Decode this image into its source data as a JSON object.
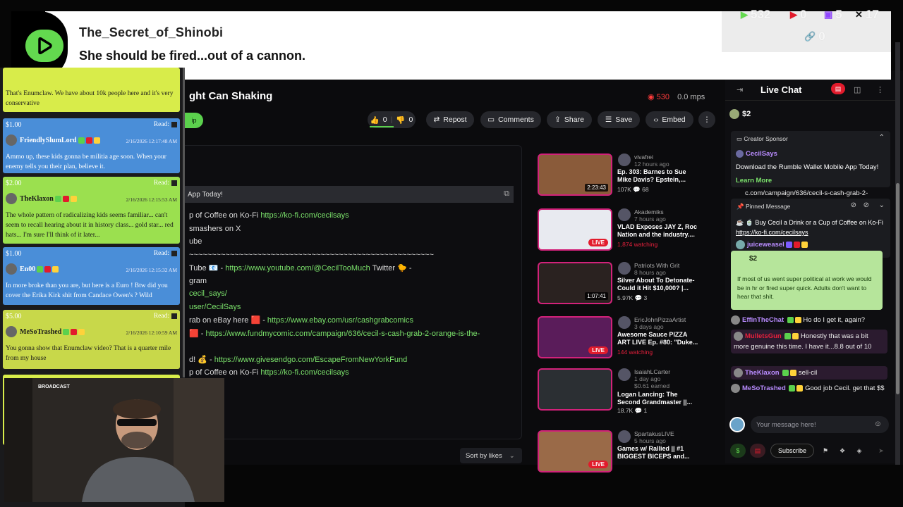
{
  "banner": {
    "username": "The_Secret_of_Shinobi",
    "message": "She should be fired...out of a cannon."
  },
  "counts": {
    "rumble": "532",
    "youtube": "0",
    "twitch": "5",
    "x": "17",
    "link": "0"
  },
  "video": {
    "title": "ght Can Shaking",
    "live_count": "530",
    "mps": "0.0 mps",
    "likes": "0",
    "dislikes": "0",
    "tip_label": "ip",
    "buttons": {
      "repost": "Repost",
      "comments": "Comments",
      "share": "Share",
      "save": "Save",
      "embed": "Embed"
    },
    "sponsor_bar": "App Today!",
    "sort_label": "Sort by likes"
  },
  "description": [
    {
      "text": "p of Coffee on Ko-Fi ",
      "link": "https://ko-fi.com/cecilsays"
    },
    {
      "text": "smashers on X",
      "link": ""
    },
    {
      "text": "ube",
      "link": ""
    },
    {
      "text": "~~~~~~~~~~~~~~~~~~~~~~~~~~~~~~~~~~~~~~~~~~~~~~~~~~~~~~",
      "link": ""
    },
    {
      "text": "Tube 📧 - ",
      "link": "https://www.youtube.com/@CecilTooMuch",
      "after": " Twitter 🐤 -"
    },
    {
      "text": "gram",
      "link": ""
    },
    {
      "text": "",
      "link": "cecil_says/"
    },
    {
      "text": "",
      "link": "user/CecilSays"
    },
    {
      "text": "rab on eBay here 🟥 - ",
      "link": "https://www.ebay.com/usr/cashgrabcomics"
    },
    {
      "text": " 🟥 - ",
      "link": "https://www.fundmycomic.com/campaign/636/cecil-s-cash-grab-2-orange-is-the-"
    },
    {
      "text": "",
      "link": ""
    },
    {
      "text": "d! 💰 - ",
      "link": "https://www.givesendgo.com/EscapeFromNewYorkFund"
    },
    {
      "text": "p of Coffee on Ko-Fi ",
      "link": "https://ko-fi.com/cecilsays"
    }
  ],
  "recommended": [
    {
      "channel": "vivafrei",
      "ago": "12 hours ago",
      "title": "Ep. 303: Barnes to Sue Mike Davis? Epstein,...",
      "meta": "107K   💬 68",
      "duration": "2:23:43",
      "live": false
    },
    {
      "channel": "Akademiks",
      "ago": "7 hours ago",
      "title": "VLAD Exposes JAY Z, Roc Nation and the industry....",
      "meta": "1,874 watching",
      "duration": "",
      "live": true
    },
    {
      "channel": "Patriots With Grit",
      "ago": "8 hours ago",
      "title": "Silver About To Detonate- Could it Hit $10,000? |...",
      "meta": "5.97K   💬 3",
      "duration": "1:07:41",
      "live": false
    },
    {
      "channel": "EricJohnPizzaArtist",
      "ago": "3 days ago",
      "title": "Awesome Sauce PIZZA ART LIVE Ep. #80: \"Duke...",
      "meta": "144 watching",
      "duration": "",
      "live": true
    },
    {
      "channel": "IsaiahLCarter",
      "ago": "1 day ago",
      "title": "Logan Lancing: The Second Grandmaster ||...",
      "meta": "18.7K   💬 1",
      "earned": "$0.61 earned",
      "duration": "",
      "live": false
    },
    {
      "channel": "SpartakusLIVE",
      "ago": "5 hours ago",
      "title": "Games w/ Rallied || #1 BIGGEST BICEPS and...",
      "meta": "",
      "duration": "",
      "live": true
    }
  ],
  "donations": [
    {
      "amount": "",
      "read": "",
      "user": "",
      "date": "",
      "text": "That's Enumclaw. We have about 10k people here and it's very conservative",
      "color": "#d8ec4a"
    },
    {
      "amount": "$1.00",
      "read": "Read:",
      "user": "FriendlySlumLord",
      "date": "2/16/2026 12:17:48 AM",
      "text": "Ammo up, these kids gonna be militia age soon. When your enemy tells you their plan, believe it.",
      "color": "#4a8ed8"
    },
    {
      "amount": "$2.00",
      "read": "Read:",
      "user": "TheKlaxon",
      "date": "2/16/2026 12:15:53 AM",
      "text": "The whole pattern of radicalizing kids seems familiar... can't seem to recall hearing about it in history class... gold star... red hats... I'm sure I'll think of it later...",
      "color": "#9be04f"
    },
    {
      "amount": "$1.00",
      "read": "Read:",
      "user": "En00",
      "date": "2/16/2026 12:15:32 AM",
      "text": "In more broke than you are, but here is a Euro ! Btw did you cover the Erika Kirk shit from Candace Owen's ? Wild",
      "color": "#4a8ed8"
    },
    {
      "amount": "$5.00",
      "read": "Read:",
      "user": "MeSoTrashed",
      "date": "2/16/2026 12:10:59 AM",
      "text": "You gonna show that Enumclaw video? That is a quarter mile from my house",
      "color": "#c8d84a"
    }
  ],
  "webcam_label": "BROADCAST",
  "chat": {
    "title": "Live Chat",
    "tip_strip": "$2",
    "sponsor_title": "Creator Sponsor",
    "sponsor_user": "CecilSays",
    "sponsor_text": "Download the Rumble Wallet Mobile App Today!",
    "sponsor_learn": "Learn More",
    "sponsor_peek": "c.com/campaign/636/cecil-s-cash-grab-2-",
    "pinned_title": "Pinned Message",
    "pinned_text": "☕ 🍵 Buy Cecil a Drink or a Cup of Coffee on Ko-Fi ",
    "pinned_link": "https://ko-fi.com/cecilsays",
    "pinned_user": "juiceweasel",
    "tip_amount": "$2",
    "tip_text": "If most of us went super political at work we would be in hr or fired super quick. Adults don't want to hear that shit.",
    "messages": [
      {
        "user": "EffinTheChat",
        "text": "Ho do I get it, again?",
        "color": "#b98cff",
        "hl": false
      },
      {
        "user": "MulletsGun",
        "text": "Honestly that was a bit more genuine this time. I have it...8.8 out of 10",
        "color": "#e6203c",
        "hl": true
      },
      {
        "user": "TheKlaxon",
        "text": "sell-cil",
        "color": "#b98cff",
        "hl": true
      },
      {
        "user": "MeSoTrashed",
        "text": "Good job Cecil. get that $$",
        "color": "#b98cff",
        "hl": false
      }
    ],
    "input_placeholder": "Your message here!",
    "subscribe": "Subscribe"
  }
}
